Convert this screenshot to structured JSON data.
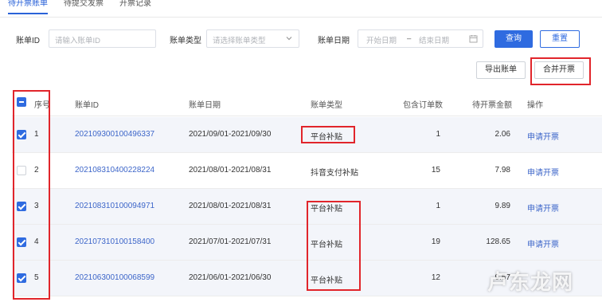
{
  "tabs": [
    {
      "label": "待开票账单",
      "active": true
    },
    {
      "label": "待提交发票",
      "active": false
    },
    {
      "label": "开票记录",
      "active": false
    }
  ],
  "filters": {
    "bill_id_label": "账单ID",
    "bill_id_placeholder": "请输入账单ID",
    "bill_type_label": "账单类型",
    "bill_type_placeholder": "请选择账单类型",
    "bill_date_label": "账单日期",
    "start_placeholder": "开始日期",
    "range_sep": "–",
    "end_placeholder": "结束日期",
    "query_button": "查询",
    "reset_button": "重置"
  },
  "actions": {
    "export_button": "导出账单",
    "merge_button": "合并开票"
  },
  "table": {
    "columns": [
      "序号",
      "账单ID",
      "账单日期",
      "账单类型",
      "包含订单数",
      "待开票金额",
      "操作"
    ],
    "rows": [
      {
        "index": "1",
        "checked": true,
        "bill_id": "202109300100496337",
        "date": "2021/09/01-2021/09/30",
        "type": "平台补贴",
        "orders": "1",
        "amount": "2.06",
        "action": "申请开票"
      },
      {
        "index": "2",
        "checked": false,
        "bill_id": "202108310400228224",
        "date": "2021/08/01-2021/08/31",
        "type": "抖音支付补贴",
        "orders": "15",
        "amount": "7.98",
        "action": "申请开票"
      },
      {
        "index": "3",
        "checked": true,
        "bill_id": "202108310100094971",
        "date": "2021/08/01-2021/08/31",
        "type": "平台补贴",
        "orders": "1",
        "amount": "9.89",
        "action": "申请开票"
      },
      {
        "index": "4",
        "checked": true,
        "bill_id": "202107310100158400",
        "date": "2021/07/01-2021/07/31",
        "type": "平台补贴",
        "orders": "19",
        "amount": "128.65",
        "action": "申请开票"
      },
      {
        "index": "5",
        "checked": true,
        "bill_id": "202106300100068599",
        "date": "2021/06/01-2021/06/30",
        "type": "平台补贴",
        "orders": "12",
        "amount": "9.57",
        "action": ""
      }
    ]
  },
  "watermark": "卢东龙网",
  "colors": {
    "accent": "#2f6be0",
    "link": "#3d66c9",
    "highlight": "#e1252b"
  }
}
